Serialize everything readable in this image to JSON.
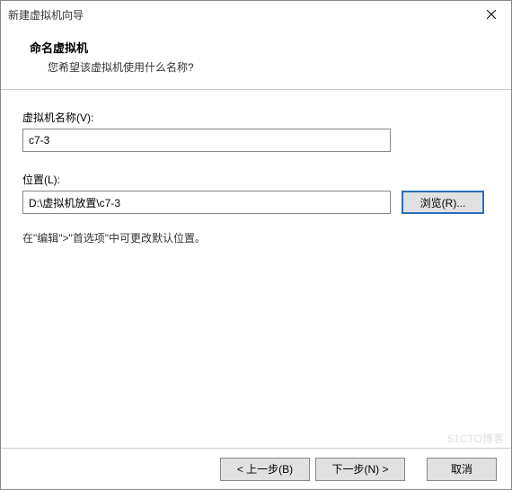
{
  "titlebar": {
    "title": "新建虚拟机向导"
  },
  "header": {
    "title": "命名虚拟机",
    "subtitle": "您希望该虚拟机使用什么名称?"
  },
  "fields": {
    "name_label": "虚拟机名称(V):",
    "name_value": "c7-3",
    "location_label": "位置(L):",
    "location_value": "D:\\虚拟机放置\\c7-3",
    "browse_label": "浏览(R)..."
  },
  "hint": "在\"编辑\">\"首选项\"中可更改默认位置。",
  "footer": {
    "back": "< 上一步(B)",
    "next": "下一步(N) >",
    "cancel": "取消"
  },
  "watermark": "51CTO博客"
}
